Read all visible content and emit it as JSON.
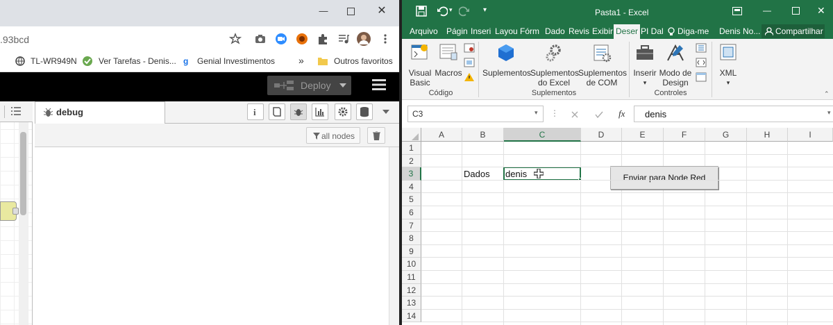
{
  "chrome": {
    "url_fragment": ".93bcd",
    "bookmarks": [
      "TL-WR949N",
      "Ver Tarefas - Denis...",
      "Genial Investimentos",
      "»",
      "Outros favoritos"
    ]
  },
  "nodered": {
    "deploy_label": "Deploy",
    "debug_tab_label": "debug",
    "filter_label": "all nodes"
  },
  "excel": {
    "title": "Pasta1 - Excel",
    "tabs": [
      "Arquivo",
      "Págin",
      "Inseri",
      "Layou",
      "Fórm",
      "Dado",
      "Revis",
      "Exibir",
      "Deser",
      "PI Dal",
      "Diga-me",
      "Denis No...",
      "Compartilhar"
    ],
    "active_tab": "Deser",
    "ribbon": {
      "visual_basic": [
        "Visual",
        "Basic"
      ],
      "macros": "Macros",
      "group_codigo": "Código",
      "suplementos": "Suplementos",
      "suplementos_excel": [
        "Suplementos",
        "do Excel"
      ],
      "suplementos_com": [
        "Suplementos",
        "de COM"
      ],
      "group_suplementos": "Suplementos",
      "inserir": "Inserir",
      "modo_design": [
        "Modo de",
        "Design"
      ],
      "group_controles": "Controles",
      "xml": "XML"
    },
    "namebox": "C3",
    "fx": "fx",
    "formula_value": "denis",
    "columns": [
      "A",
      "B",
      "C",
      "D",
      "E",
      "F",
      "G",
      "H",
      "I"
    ],
    "rows": [
      "1",
      "2",
      "3",
      "4",
      "5",
      "6",
      "7",
      "8",
      "9",
      "10",
      "11",
      "12",
      "13",
      "14"
    ],
    "cells": {
      "B3": "Dados",
      "C3": "denis"
    },
    "macro_button": "Enviar para Node Red",
    "accent_color": "#217346"
  }
}
